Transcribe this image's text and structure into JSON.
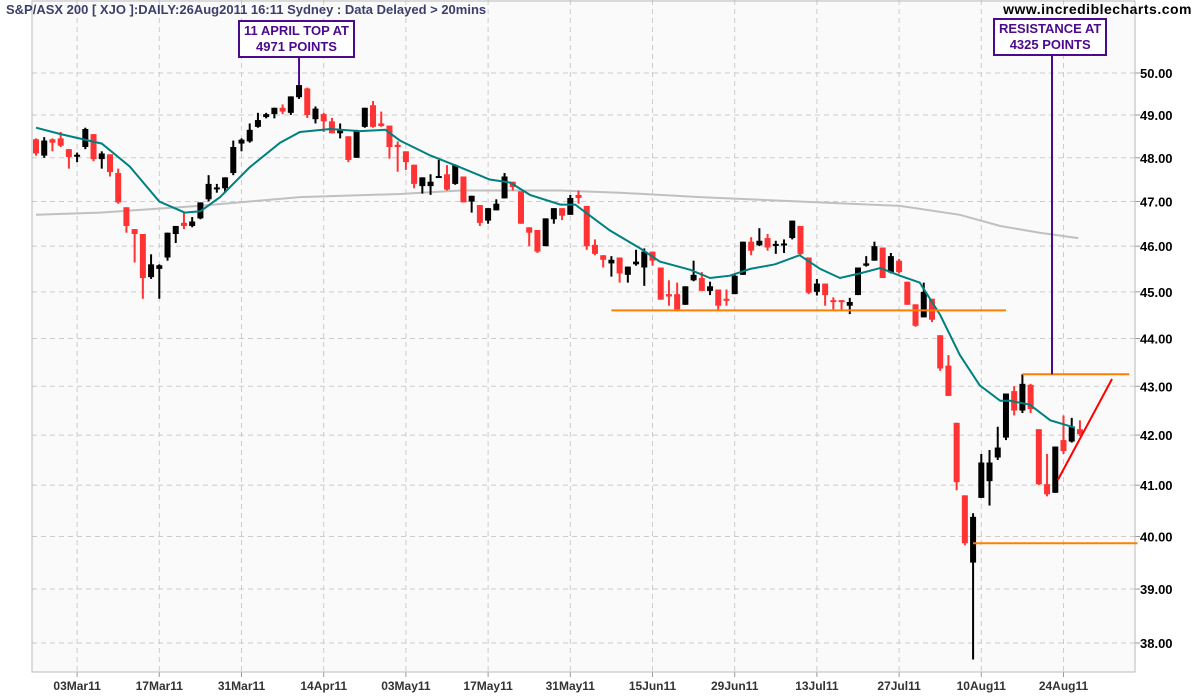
{
  "header": {
    "title": "S&P/ASX 200 [ XJO ]:DAILY:26Aug2011 16:11 Sydney : Data Delayed > 20mins",
    "website": "www.incrediblecharts.com"
  },
  "annotations": [
    {
      "line1": "11 APRIL TOP AT",
      "line2": "4971 POINTS",
      "index": 32,
      "price": 49.71
    },
    {
      "line1": "RESISTANCE AT",
      "line2": "4325 POINTS",
      "index": 123,
      "price": 43.25
    }
  ],
  "colors": {
    "up": "#000000",
    "down": "#ff3333",
    "ema": "#008080",
    "ma": "#c0c0c0",
    "levels": "#ff8000",
    "trend": "#ff0000",
    "annotation": "#4b0a8c",
    "grid": "#cccccc"
  },
  "chart_data": {
    "type": "candlestick",
    "title": "S&P/ASX 200 [ XJO ]:DAILY:26Aug2011",
    "yscale": "log",
    "ylim": [
      37.6,
      51.2
    ],
    "yticks": [
      "50.00",
      "49.00",
      "48.00",
      "47.00",
      "46.00",
      "45.00",
      "44.00",
      "43.00",
      "42.00",
      "41.00",
      "40.00",
      "39.00",
      "38.00"
    ],
    "xticks": [
      {
        "index": 5,
        "label": "03Mar11"
      },
      {
        "index": 15,
        "label": "17Mar11"
      },
      {
        "index": 25,
        "label": "31Mar11"
      },
      {
        "index": 35,
        "label": "14Apr11"
      },
      {
        "index": 45,
        "label": "03May11"
      },
      {
        "index": 55,
        "label": "17May11"
      },
      {
        "index": 65,
        "label": "31May11"
      },
      {
        "index": 75,
        "label": "15Jun11"
      },
      {
        "index": 85,
        "label": "29Jun11"
      },
      {
        "index": 95,
        "label": "13Jul11"
      },
      {
        "index": 105,
        "label": "27Jul11"
      },
      {
        "index": 115,
        "label": "10Aug11"
      },
      {
        "index": 125,
        "label": "24Aug11"
      }
    ],
    "ohlc": [
      [
        48.43,
        48.45,
        48.05,
        48.1
      ],
      [
        48.05,
        48.48,
        48.0,
        48.4
      ],
      [
        48.43,
        48.45,
        48.15,
        48.35
      ],
      [
        48.45,
        48.6,
        48.25,
        48.28
      ],
      [
        48.2,
        48.2,
        47.75,
        48.02
      ],
      [
        48.03,
        48.12,
        47.9,
        48.07
      ],
      [
        48.25,
        48.7,
        48.2,
        48.67
      ],
      [
        48.55,
        48.55,
        47.92,
        47.97
      ],
      [
        47.97,
        48.15,
        47.75,
        48.1
      ],
      [
        48.08,
        48.08,
        47.57,
        47.67
      ],
      [
        47.65,
        47.75,
        46.95,
        46.98
      ],
      [
        46.87,
        46.87,
        46.3,
        46.45
      ],
      [
        46.38,
        46.38,
        45.64,
        46.27
      ],
      [
        46.27,
        46.27,
        44.85,
        45.3
      ],
      [
        45.32,
        45.82,
        45.28,
        45.6
      ],
      [
        45.5,
        45.6,
        44.85,
        45.58
      ],
      [
        45.75,
        46.3,
        45.68,
        46.3
      ],
      [
        46.27,
        46.45,
        46.07,
        46.45
      ],
      [
        46.52,
        46.75,
        46.38,
        46.45
      ],
      [
        46.45,
        46.65,
        46.42,
        46.55
      ],
      [
        46.62,
        46.98,
        46.6,
        46.98
      ],
      [
        47.05,
        47.6,
        47.0,
        47.4
      ],
      [
        47.28,
        47.4,
        47.2,
        47.32
      ],
      [
        47.3,
        47.55,
        47.2,
        47.55
      ],
      [
        47.65,
        48.4,
        47.6,
        48.25
      ],
      [
        48.33,
        48.45,
        48.15,
        48.42
      ],
      [
        48.38,
        48.8,
        48.35,
        48.65
      ],
      [
        48.72,
        49.05,
        48.7,
        48.88
      ],
      [
        48.95,
        49.05,
        48.92,
        49.02
      ],
      [
        49.02,
        49.17,
        48.92,
        49.17
      ],
      [
        49.17,
        49.25,
        49.02,
        49.08
      ],
      [
        49.05,
        49.44,
        49.0,
        49.44
      ],
      [
        49.42,
        49.71,
        49.38,
        49.71
      ],
      [
        49.63,
        49.65,
        48.93,
        49.0
      ],
      [
        48.9,
        49.2,
        48.8,
        49.15
      ],
      [
        49.02,
        49.05,
        48.6,
        48.85
      ],
      [
        48.85,
        48.93,
        48.57,
        48.57
      ],
      [
        48.57,
        48.8,
        48.45,
        48.67
      ],
      [
        48.5,
        48.5,
        47.9,
        47.95
      ],
      [
        48.0,
        48.65,
        48.0,
        48.63
      ],
      [
        48.72,
        49.17,
        48.7,
        49.17
      ],
      [
        49.23,
        49.33,
        48.7,
        48.72
      ],
      [
        48.8,
        49.08,
        48.72,
        48.74
      ],
      [
        48.75,
        48.75,
        47.98,
        48.25
      ],
      [
        48.3,
        48.38,
        47.68,
        48.25
      ],
      [
        48.15,
        48.15,
        47.72,
        47.9
      ],
      [
        47.84,
        47.84,
        47.3,
        47.4
      ],
      [
        47.35,
        47.55,
        47.18,
        47.55
      ],
      [
        47.35,
        47.62,
        47.15,
        47.45
      ],
      [
        47.55,
        47.95,
        47.55,
        47.58
      ],
      [
        47.62,
        47.83,
        47.25,
        47.27
      ],
      [
        47.4,
        47.85,
        47.38,
        47.83
      ],
      [
        47.57,
        47.57,
        46.98,
        46.98
      ],
      [
        47.0,
        47.13,
        46.75,
        47.13
      ],
      [
        46.92,
        46.92,
        46.45,
        46.52
      ],
      [
        46.57,
        46.85,
        46.5,
        46.85
      ],
      [
        46.8,
        47.05,
        46.8,
        46.95
      ],
      [
        47.07,
        47.65,
        47.07,
        47.57
      ],
      [
        47.45,
        47.45,
        47.25,
        47.33
      ],
      [
        47.23,
        47.23,
        46.5,
        46.5
      ],
      [
        46.42,
        46.42,
        46.0,
        46.3
      ],
      [
        46.36,
        46.36,
        45.85,
        45.88
      ],
      [
        46.0,
        46.62,
        46.0,
        46.62
      ],
      [
        46.6,
        46.85,
        46.5,
        46.85
      ],
      [
        46.85,
        46.85,
        46.58,
        46.68
      ],
      [
        46.7,
        47.15,
        46.7,
        47.08
      ],
      [
        47.15,
        47.25,
        46.95,
        47.08
      ],
      [
        46.9,
        46.9,
        45.92,
        46.0
      ],
      [
        46.03,
        46.15,
        45.8,
        45.83
      ],
      [
        45.8,
        45.8,
        45.53,
        45.7
      ],
      [
        45.62,
        45.78,
        45.33,
        45.7
      ],
      [
        45.75,
        45.75,
        45.2,
        45.4
      ],
      [
        45.37,
        45.55,
        45.2,
        45.55
      ],
      [
        45.6,
        45.92,
        45.57,
        45.66
      ],
      [
        45.53,
        45.95,
        45.13,
        45.88
      ],
      [
        45.88,
        45.88,
        45.57,
        45.68
      ],
      [
        45.53,
        45.53,
        44.83,
        44.83
      ],
      [
        44.95,
        45.25,
        44.7,
        44.9
      ],
      [
        44.95,
        45.2,
        44.58,
        44.6
      ],
      [
        44.72,
        45.12,
        44.72,
        45.12
      ],
      [
        45.25,
        45.68,
        45.23,
        45.37
      ],
      [
        45.3,
        45.43,
        45.02,
        45.02
      ],
      [
        45.02,
        45.22,
        44.93,
        45.12
      ],
      [
        45.05,
        45.05,
        44.6,
        44.7
      ],
      [
        44.85,
        45.05,
        44.7,
        44.82
      ],
      [
        44.95,
        45.4,
        44.95,
        45.35
      ],
      [
        45.37,
        46.1,
        45.37,
        46.1
      ],
      [
        46.1,
        46.2,
        45.8,
        45.9
      ],
      [
        46.02,
        46.4,
        46.0,
        46.12
      ],
      [
        46.18,
        46.27,
        45.9,
        45.97
      ],
      [
        46.02,
        46.12,
        45.83,
        46.05
      ],
      [
        46.03,
        46.15,
        45.85,
        46.06
      ],
      [
        46.18,
        46.57,
        46.15,
        46.57
      ],
      [
        46.45,
        46.45,
        45.8,
        45.83
      ],
      [
        45.75,
        45.75,
        44.95,
        44.98
      ],
      [
        45.0,
        45.28,
        44.92,
        45.18
      ],
      [
        45.18,
        45.18,
        44.7,
        44.93
      ],
      [
        44.82,
        44.88,
        44.62,
        44.8
      ],
      [
        44.82,
        44.82,
        44.6,
        44.79
      ],
      [
        44.7,
        44.87,
        44.52,
        44.78
      ],
      [
        44.93,
        45.53,
        44.93,
        45.53
      ],
      [
        45.57,
        45.78,
        45.55,
        45.62
      ],
      [
        45.68,
        46.1,
        45.68,
        46.0
      ],
      [
        45.97,
        45.97,
        45.3,
        45.3
      ],
      [
        45.42,
        45.85,
        45.4,
        45.78
      ],
      [
        45.68,
        45.72,
        45.4,
        45.43
      ],
      [
        45.22,
        45.22,
        44.72,
        44.72
      ],
      [
        44.73,
        44.73,
        44.25,
        44.27
      ],
      [
        44.45,
        45.2,
        44.45,
        45.0
      ],
      [
        44.85,
        44.85,
        44.35,
        44.4
      ],
      [
        44.07,
        44.07,
        43.32,
        43.37
      ],
      [
        43.43,
        43.65,
        42.8,
        42.8
      ],
      [
        42.25,
        42.25,
        40.9,
        41.06
      ],
      [
        40.8,
        40.8,
        39.83,
        39.87
      ],
      [
        39.5,
        40.45,
        37.7,
        40.38
      ],
      [
        40.75,
        41.62,
        40.75,
        41.45
      ],
      [
        41.08,
        41.7,
        40.6,
        41.45
      ],
      [
        41.55,
        42.17,
        41.5,
        41.75
      ],
      [
        41.95,
        42.85,
        41.9,
        42.85
      ],
      [
        42.9,
        43.0,
        42.4,
        42.5
      ],
      [
        42.5,
        43.25,
        42.45,
        43.05
      ],
      [
        43.03,
        43.05,
        42.45,
        42.53
      ],
      [
        42.12,
        42.12,
        41.0,
        41.02
      ],
      [
        41.02,
        41.62,
        40.78,
        40.82
      ],
      [
        40.85,
        41.77,
        40.85,
        41.77
      ],
      [
        41.9,
        42.4,
        41.62,
        41.68
      ],
      [
        41.87,
        42.35,
        41.85,
        42.17
      ],
      [
        42.12,
        42.3,
        41.98,
        42.02
      ]
    ],
    "series": [
      {
        "name": "short EMA",
        "points": [
          [
            0,
            48.7
          ],
          [
            3,
            48.55
          ],
          [
            8,
            48.33
          ],
          [
            11.4,
            47.8
          ],
          [
            15,
            47.0
          ],
          [
            18.1,
            46.75
          ],
          [
            20,
            46.78
          ],
          [
            22.4,
            47.1
          ],
          [
            26,
            47.78
          ],
          [
            29.7,
            48.35
          ],
          [
            32.1,
            48.6
          ],
          [
            35.8,
            48.67
          ],
          [
            39.4,
            48.62
          ],
          [
            42.5,
            48.65
          ],
          [
            44.3,
            48.4
          ],
          [
            48,
            48.05
          ],
          [
            51.6,
            47.78
          ],
          [
            55.2,
            47.5
          ],
          [
            57.7,
            47.43
          ],
          [
            60.1,
            47.15
          ],
          [
            63.8,
            46.93
          ],
          [
            65.6,
            46.93
          ],
          [
            67.4,
            46.68
          ],
          [
            69.8,
            46.35
          ],
          [
            73.5,
            45.95
          ],
          [
            75.9,
            45.66
          ],
          [
            79.6,
            45.48
          ],
          [
            82,
            45.3
          ],
          [
            84.4,
            45.35
          ],
          [
            86.9,
            45.5
          ],
          [
            89.9,
            45.6
          ],
          [
            92.9,
            45.8
          ],
          [
            95.4,
            45.5
          ],
          [
            97.8,
            45.3
          ],
          [
            100.2,
            45.4
          ],
          [
            102.7,
            45.52
          ],
          [
            105.1,
            45.35
          ],
          [
            107.5,
            45.2
          ],
          [
            110,
            44.5
          ],
          [
            112.4,
            43.65
          ],
          [
            114.8,
            43.02
          ],
          [
            117.3,
            42.7
          ],
          [
            118.5,
            42.7
          ],
          [
            120.9,
            42.62
          ],
          [
            123.4,
            42.3
          ],
          [
            126.4,
            42.15
          ]
        ]
      },
      {
        "name": "long MA",
        "points": [
          [
            0,
            46.7
          ],
          [
            7.8,
            46.75
          ],
          [
            19.9,
            46.9
          ],
          [
            32.1,
            47.1
          ],
          [
            44.3,
            47.17
          ],
          [
            51.6,
            47.25
          ],
          [
            63.8,
            47.25
          ],
          [
            71,
            47.2
          ],
          [
            80.8,
            47.1
          ],
          [
            92.9,
            47.0
          ],
          [
            105.1,
            46.9
          ],
          [
            112.4,
            46.7
          ],
          [
            117.3,
            46.45
          ],
          [
            122.1,
            46.3
          ],
          [
            126.8,
            46.18
          ]
        ]
      }
    ],
    "levels": [
      {
        "name": "support",
        "price": 44.6,
        "from": 70,
        "to": 118
      },
      {
        "name": "resistance",
        "price": 43.25,
        "from": 120,
        "to": 133
      },
      {
        "name": "low-support",
        "price": 39.87,
        "from": 114,
        "to": 134
      }
    ],
    "trendline": {
      "from": [
        124.3,
        41.1
      ],
      "to": [
        130.9,
        43.15
      ]
    }
  }
}
